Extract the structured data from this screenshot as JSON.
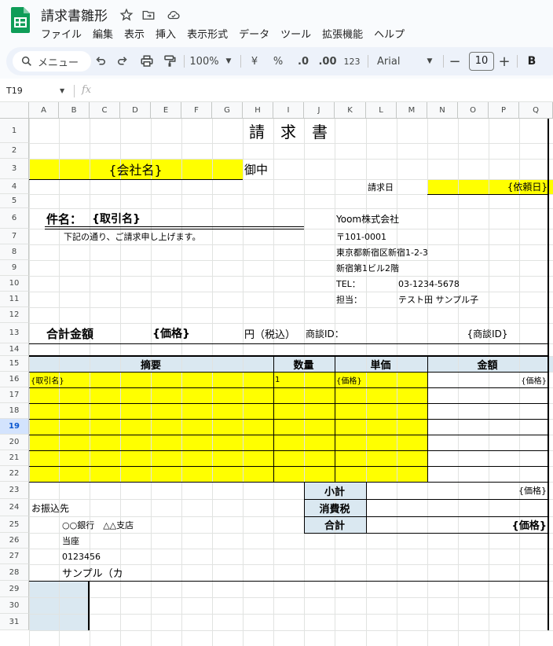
{
  "doc": {
    "title": "請求書雛形"
  },
  "menu": [
    "ファイル",
    "編集",
    "表示",
    "挿入",
    "表示形式",
    "データ",
    "ツール",
    "拡張機能",
    "ヘルプ"
  ],
  "toolbar": {
    "search_label": "メニュー",
    "zoom": "100%",
    "currency": "¥",
    "percent": "%",
    "dec_decrease": ".0",
    "dec_increase": ".00",
    "number_format": "123",
    "font": "Arial",
    "font_size": "10",
    "bold": "B"
  },
  "formula_bar": {
    "cell_ref": "T19",
    "fx": "fx"
  },
  "grid": {
    "columns": [
      "A",
      "B",
      "C",
      "D",
      "E",
      "F",
      "G",
      "H",
      "I",
      "J",
      "K",
      "L",
      "M",
      "N",
      "O",
      "P",
      "Q"
    ],
    "rows": [
      "1",
      "2",
      "3",
      "4",
      "5",
      "6",
      "7",
      "8",
      "9",
      "10",
      "11",
      "12",
      "13",
      "14",
      "15",
      "16",
      "17",
      "18",
      "19",
      "20",
      "21",
      "22",
      "23",
      "24",
      "25",
      "26",
      "27",
      "28",
      "29",
      "30",
      "31"
    ],
    "selected_row": "19"
  },
  "sheet": {
    "title": "請　求　書",
    "company_placeholder": "{会社名}",
    "onchu": "御中",
    "invoice_date_label": "請求日",
    "invoice_date_value": "{依頼日}",
    "subject_label": "件名：",
    "subject_value": "{取引名}",
    "greeting": "下記の通り、ご請求申し上げます。",
    "issuer": {
      "name": "Yoom株式会社",
      "postal": "〒101-0001",
      "address1": "東京都新宿区新宿1-2-3",
      "address2": "新宿第1ビル2階",
      "tel_label": "TEL：",
      "tel_value": "03-1234-5678",
      "person_label": "担当：",
      "person_value": "テスト田 サンプル子"
    },
    "total_label": "合計金額",
    "total_value": "{価格}",
    "tax_note": "円（税込）",
    "deal_id_label": "商談ID：",
    "deal_id_value": "{商談ID}",
    "table_headers": [
      "摘要",
      "数量",
      "単価",
      "金額"
    ],
    "item_row": {
      "desc": "{取引名}",
      "qty": "1",
      "unit_price": "{価格}",
      "amount": "{価格}"
    },
    "summary": [
      {
        "label": "小計",
        "value": "{価格}"
      },
      {
        "label": "消費税",
        "value": ""
      },
      {
        "label": "合計",
        "value": "{価格}"
      }
    ],
    "bank": {
      "heading": "お振込先",
      "bank_name": "○○銀行　△△支店",
      "account_type": "当座",
      "account_no": "0123456",
      "holder": "サンプル（カ"
    }
  },
  "colors": {
    "yellow": "#ffff00",
    "header_blue": "#dae8f1",
    "selected_row": "#d3e3fd",
    "logo_green": "#0f9d58"
  }
}
